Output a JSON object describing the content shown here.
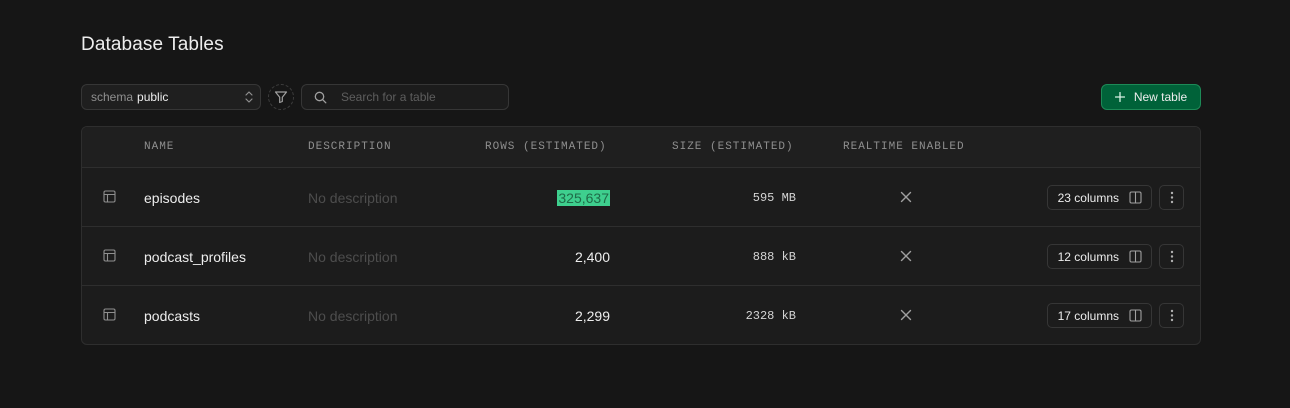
{
  "page": {
    "title": "Database Tables"
  },
  "toolbar": {
    "schema_label": "schema",
    "schema_value": "public",
    "search_placeholder": "Search for a table",
    "new_table_label": "New table",
    "accent": "#006239"
  },
  "table": {
    "headers": [
      "NAME",
      "DESCRIPTION",
      "ROWS (ESTIMATED)",
      "SIZE (ESTIMATED)",
      "REALTIME ENABLED"
    ],
    "rows": [
      {
        "name": "episodes",
        "description": "No description",
        "rows": "325,637",
        "size": "595 MB",
        "realtime": "disabled",
        "columns": "23 columns",
        "rows_highlighted": true
      },
      {
        "name": "podcast_profiles",
        "description": "No description",
        "rows": "2,400",
        "size": "888 kB",
        "realtime": "disabled",
        "columns": "12 columns",
        "rows_highlighted": false
      },
      {
        "name": "podcasts",
        "description": "No description",
        "rows": "2,299",
        "size": "2328 kB",
        "realtime": "disabled",
        "columns": "17 columns",
        "rows_highlighted": false
      }
    ]
  },
  "colors": {
    "highlight": "#3ecf8e",
    "background": "#161616"
  }
}
